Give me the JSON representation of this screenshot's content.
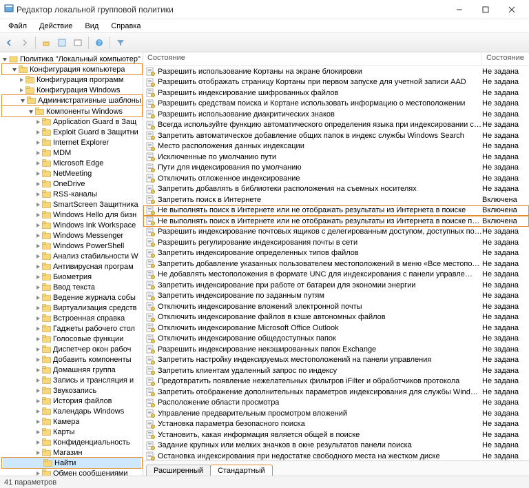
{
  "title": "Редактор локальной групповой политики",
  "menus": [
    "Файл",
    "Действие",
    "Вид",
    "Справка"
  ],
  "tree_root": "Политика \"Локальный компьютер\"",
  "tree_l1": "Конфигурация компьютера",
  "tree_l1_siblings": [
    "Конфигурация программ",
    "Конфигурация Windows"
  ],
  "tree_l2": "Административные шаблоны",
  "tree_l3": "Компоненты Windows",
  "tree_items": [
    "Application Guard в Защ",
    "Exploit Guard в Защитни",
    "Internet Explorer",
    "MDM",
    "Microsoft Edge",
    "NetMeeting",
    "OneDrive",
    "RSS-каналы",
    "SmartScreen Защитника",
    "Windows Hello для бизн",
    "Windows Ink Workspace",
    "Windows Messenger",
    "Windows PowerShell",
    "Анализ стабильности W",
    "Антивирусная програм",
    "Биометрия",
    "Ввод текста",
    "Ведение журнала собы",
    "Виртуализация средств",
    "Встроенная справка",
    "Гаджеты рабочего стол",
    "Голосовые функции",
    "Диспетчер окон рабоч",
    "Добавить компоненты",
    "Домашняя группа",
    "Запись и трансляция и",
    "Звукозапись",
    "История файлов",
    "Календарь Windows",
    "Камера",
    "Карты",
    "Конфиденциальность",
    "Магазин"
  ],
  "tree_selected": "Найти",
  "tree_after": "Обмен сообщениями",
  "list_headers": [
    "Состояние",
    "Состояние"
  ],
  "list": [
    {
      "t": "Разрешить использование Кортаны на экране блокировки",
      "s": "Не задана"
    },
    {
      "t": "Разрешить отображать страницу Кортаны при первом запуске для учетной записи AAD",
      "s": "Не задана"
    },
    {
      "t": "Разрешить индексирование шифрованных файлов",
      "s": "Не задана"
    },
    {
      "t": "Разрешить средствам поиска и Кортане использовать информацию о местоположении",
      "s": "Не задана"
    },
    {
      "t": "Разрешить использование диакритических знаков",
      "s": "Не задана"
    },
    {
      "t": "Всегда используйте функцию автоматического определения языка при индексировании содерж…",
      "s": "Не задана"
    },
    {
      "t": "Запретить автоматическое добавление общих папок в индекс службы Windows Search",
      "s": "Не задана"
    },
    {
      "t": "Место расположения данных индексации",
      "s": "Не задана"
    },
    {
      "t": "Исключенные по умолчанию пути",
      "s": "Не задана"
    },
    {
      "t": "Пути для индексирования по умолчанию",
      "s": "Не задана"
    },
    {
      "t": "Отключить отложенное индексирование",
      "s": "Не задана"
    },
    {
      "t": "Запретить добавлять в библиотеки расположения на съемных носителях",
      "s": "Не задана"
    },
    {
      "t": "Запретить поиск в Интернете",
      "s": "Включена"
    },
    {
      "t": "Не выполнять поиск в Интернете или не отображать результаты из Интернета в поиске",
      "s": "Включена",
      "hl": true
    },
    {
      "t": "Не выполнять поиск в Интернете или не отображать результаты из Интернета в поиске при исп…",
      "s": "Включена",
      "hl": true
    },
    {
      "t": "Разрешить индексирование почтовых ящиков с делегированным доступом, доступных по умол…",
      "s": "Не задана"
    },
    {
      "t": "Разрешить регулирование индексирования почты в сети",
      "s": "Не задана"
    },
    {
      "t": "Запретить индексирование определенных типов файлов",
      "s": "Не задана"
    },
    {
      "t": "Запретить добавление указанных пользователем местоположений в меню «Все местоположения»",
      "s": "Не задана"
    },
    {
      "t": "Не добавлять местоположения в формате UNC для индексирования с панели управле…",
      "s": "Не задана"
    },
    {
      "t": "Запретить индексирование при работе от батареи для экономии энергии",
      "s": "Не задана"
    },
    {
      "t": "Запретить индексирование по заданным путям",
      "s": "Не задана"
    },
    {
      "t": "Отключить индексирование вложений электронной почты",
      "s": "Не задана"
    },
    {
      "t": "Отключить индексирование файлов в кэше автономных файлов",
      "s": "Не задана"
    },
    {
      "t": "Отключить индексирование Microsoft Office Outlook",
      "s": "Не задана"
    },
    {
      "t": "Отключить индексирование общедоступных папок",
      "s": "Не задана"
    },
    {
      "t": "Разрешить индексирование некэшированных папок Exchange",
      "s": "Не задана"
    },
    {
      "t": "Запретить настройку индексируемых местоположений на панели управления",
      "s": "Не задана"
    },
    {
      "t": "Запретить клиентам удаленный запрос по индексу",
      "s": "Не задана"
    },
    {
      "t": "Предотвратить появление нежелательных фильтров iFilter и обработчиков протокола",
      "s": "Не задана"
    },
    {
      "t": "Запретить отображение дополнительных параметров индексирования для службы Windows Sear…",
      "s": "Не задана"
    },
    {
      "t": "Расположение области просмотра",
      "s": "Не задана"
    },
    {
      "t": "Управление предварительным просмотром вложений",
      "s": "Не задана"
    },
    {
      "t": "Установка параметра безопасного поиска",
      "s": "Не задана"
    },
    {
      "t": "Установить, какая информация является общей в поиске",
      "s": "Не задана"
    },
    {
      "t": "Задание крупных или мелких значков в окне результатов панели поиска",
      "s": "Не задана"
    },
    {
      "t": "Остановка индексирования при недостатке свободного места на жестком диске",
      "s": "Не задана"
    }
  ],
  "tabs": [
    "Расширенный",
    "Стандартный"
  ],
  "status": "41 параметров"
}
